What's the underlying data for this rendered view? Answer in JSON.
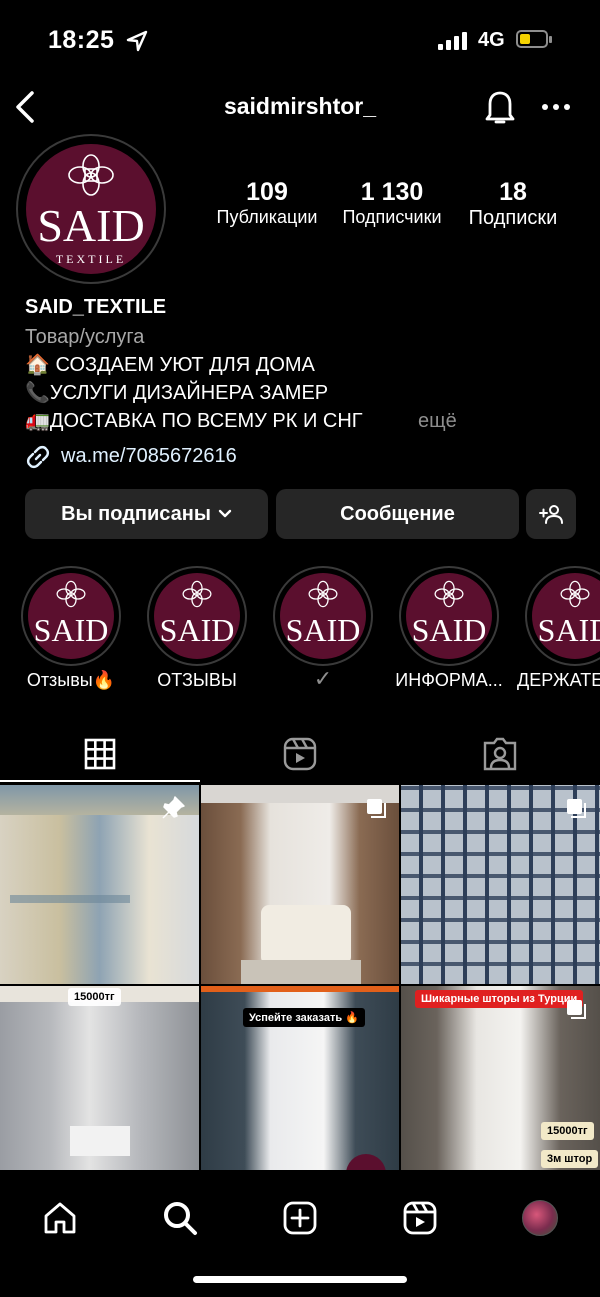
{
  "status": {
    "time": "18:25",
    "network": "4G"
  },
  "header": {
    "username": "saidmirshtor_"
  },
  "profile": {
    "logo_text": "SAID",
    "logo_sub": "TEXTILE",
    "stats": [
      {
        "value": "109",
        "label": "Публикации"
      },
      {
        "value": "1 130",
        "label": "Подписчики"
      },
      {
        "value": "18",
        "label": "Подписки"
      }
    ],
    "name": "SAID_TEXTILE",
    "category": "Товар/услуга",
    "bio_lines": [
      "🏠 СОЗДАЕМ УЮТ ДЛЯ ДОМА",
      "📞УСЛУГИ ДИЗАЙНЕРА ЗАМЕР",
      "🚛ДОСТАВКА ПО ВСЕМУ РК И СНГ"
    ],
    "more_label": "ещё",
    "link": "wa.me/7085672616"
  },
  "buttons": {
    "following": "Вы подписаны",
    "message": "Сообщение"
  },
  "highlights": [
    {
      "label": "Отзывы🔥"
    },
    {
      "label": "ОТЗЫВЫ"
    },
    {
      "label": "✓"
    },
    {
      "label": "ИНФОРМА..."
    },
    {
      "label": "ДЕРЖАТЕ"
    }
  ],
  "grid_badges": {
    "price1": "15000тг",
    "order": "Успейте заказать 🔥",
    "luxury": "Шикарные шторы из Турции",
    "price2": "15000тг",
    "size": "3м штор"
  },
  "colors": {
    "background": "#000000",
    "button_bg": "#262626",
    "brand": "#5b0f2e",
    "link": "#e0f1ff",
    "muted": "#a8a8a8"
  }
}
